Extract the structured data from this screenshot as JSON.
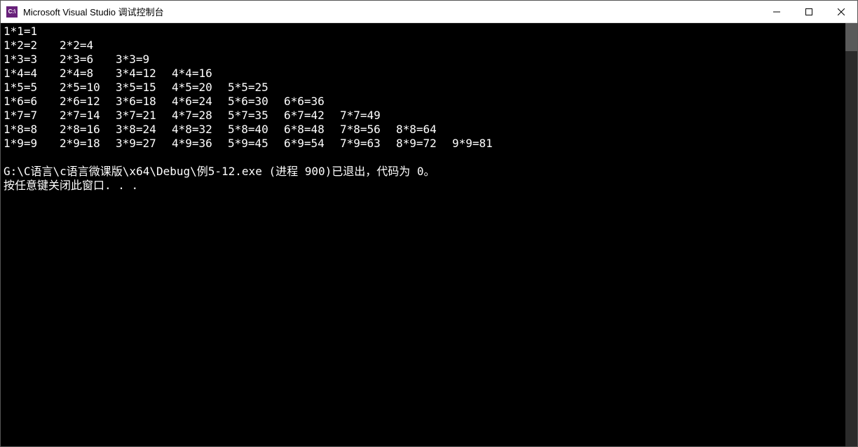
{
  "window": {
    "title": "Microsoft Visual Studio 调试控制台",
    "icon_label": "C:\\"
  },
  "table": {
    "rows": [
      [
        "1*1=1"
      ],
      [
        "1*2=2",
        "2*2=4"
      ],
      [
        "1*3=3",
        "2*3=6",
        "3*3=9"
      ],
      [
        "1*4=4",
        "2*4=8",
        "3*4=12",
        "4*4=16"
      ],
      [
        "1*5=5",
        "2*5=10",
        "3*5=15",
        "4*5=20",
        "5*5=25"
      ],
      [
        "1*6=6",
        "2*6=12",
        "3*6=18",
        "4*6=24",
        "5*6=30",
        "6*6=36"
      ],
      [
        "1*7=7",
        "2*7=14",
        "3*7=21",
        "4*7=28",
        "5*7=35",
        "6*7=42",
        "7*7=49"
      ],
      [
        "1*8=8",
        "2*8=16",
        "3*8=24",
        "4*8=32",
        "5*8=40",
        "6*8=48",
        "7*8=56",
        "8*8=64"
      ],
      [
        "1*9=9",
        "2*9=18",
        "3*9=27",
        "4*9=36",
        "5*9=45",
        "6*9=54",
        "7*9=63",
        "8*9=72",
        "9*9=81"
      ]
    ]
  },
  "footer": {
    "line1": "G:\\C语言\\c语言微课版\\x64\\Debug\\例5-12.exe (进程 900)已退出，代码为 0。",
    "line2": "按任意键关闭此窗口. . ."
  }
}
